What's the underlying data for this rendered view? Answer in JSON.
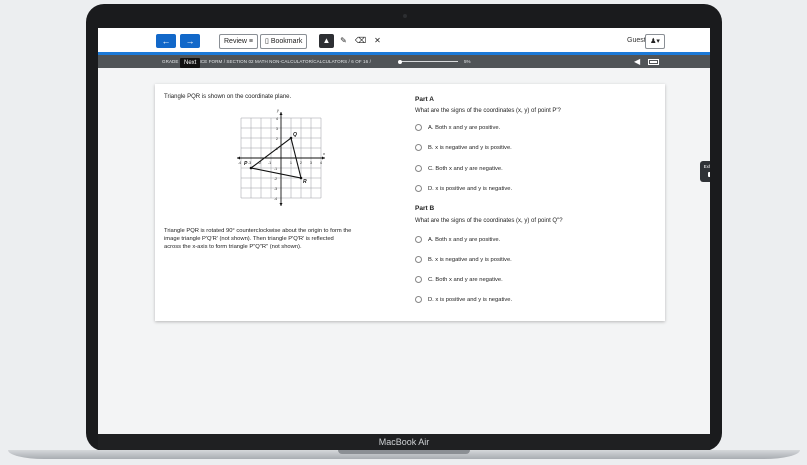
{
  "toolbar": {
    "back_icon": "arrow-left-icon",
    "next_icon": "arrow-right-icon",
    "review_label": "Review",
    "review_icon": "≡",
    "bookmark_label": "Bookmark",
    "tools": [
      "▲",
      "✎",
      "⌫",
      "✕"
    ],
    "guest_label": "Guest",
    "user_icon": "♟▾"
  },
  "tooltip": {
    "next_label": "Next"
  },
  "subbar": {
    "breadcrumb": "GRADE 8 PRACTICE FORM  /  SECTION 02 MATH NON-CALCULATOR/CALCULATORS  /  6 OF 16  /",
    "progress_percent": 5,
    "progress_label": "5%"
  },
  "question": {
    "stem": "Triangle PQR is shown on the coordinate plane.",
    "description_line1": "Triangle PQR is rotated 90° counterclockwise about the origin to form the",
    "description_line2": "image triangle P′Q′R′ (not shown). Then triangle P′Q′R′ is reflected",
    "description_line3": "across the x-axis to form triangle P″Q″R″ (not shown).",
    "graph": {
      "x_label": "x",
      "y_label": "y",
      "points": {
        "P": [
          -3,
          -1
        ],
        "Q": [
          1,
          2
        ],
        "R": [
          2,
          -2
        ]
      },
      "x_ticks": [
        "-4",
        "-3",
        "-2",
        "-1",
        "1",
        "2",
        "3",
        "4"
      ],
      "y_ticks": [
        "4",
        "3",
        "2",
        "1",
        "-1",
        "-2",
        "-3",
        "-4"
      ]
    }
  },
  "part_a": {
    "title": "Part A",
    "prompt": "What are the signs of the coordinates (x, y) of point P′?",
    "options": [
      "A.  Both x and y are positive.",
      "B.  x is negative and y is positive.",
      "C.  Both x and y are negative.",
      "D.  x is positive and y is negative."
    ]
  },
  "part_b": {
    "title": "Part B",
    "prompt": "What are the signs of the coordinates (x, y) of point Q″?",
    "options": [
      "A.  Both x and y are positive.",
      "B.  x is negative and y is positive.",
      "C.  Both x and y are negative.",
      "D.  x is positive and y is negative."
    ]
  },
  "exhibits": {
    "label": "Exhibits"
  },
  "device": {
    "brand_label": "MacBook Air"
  },
  "colors": {
    "accent": "#1268c9",
    "subbar": "#505457"
  }
}
